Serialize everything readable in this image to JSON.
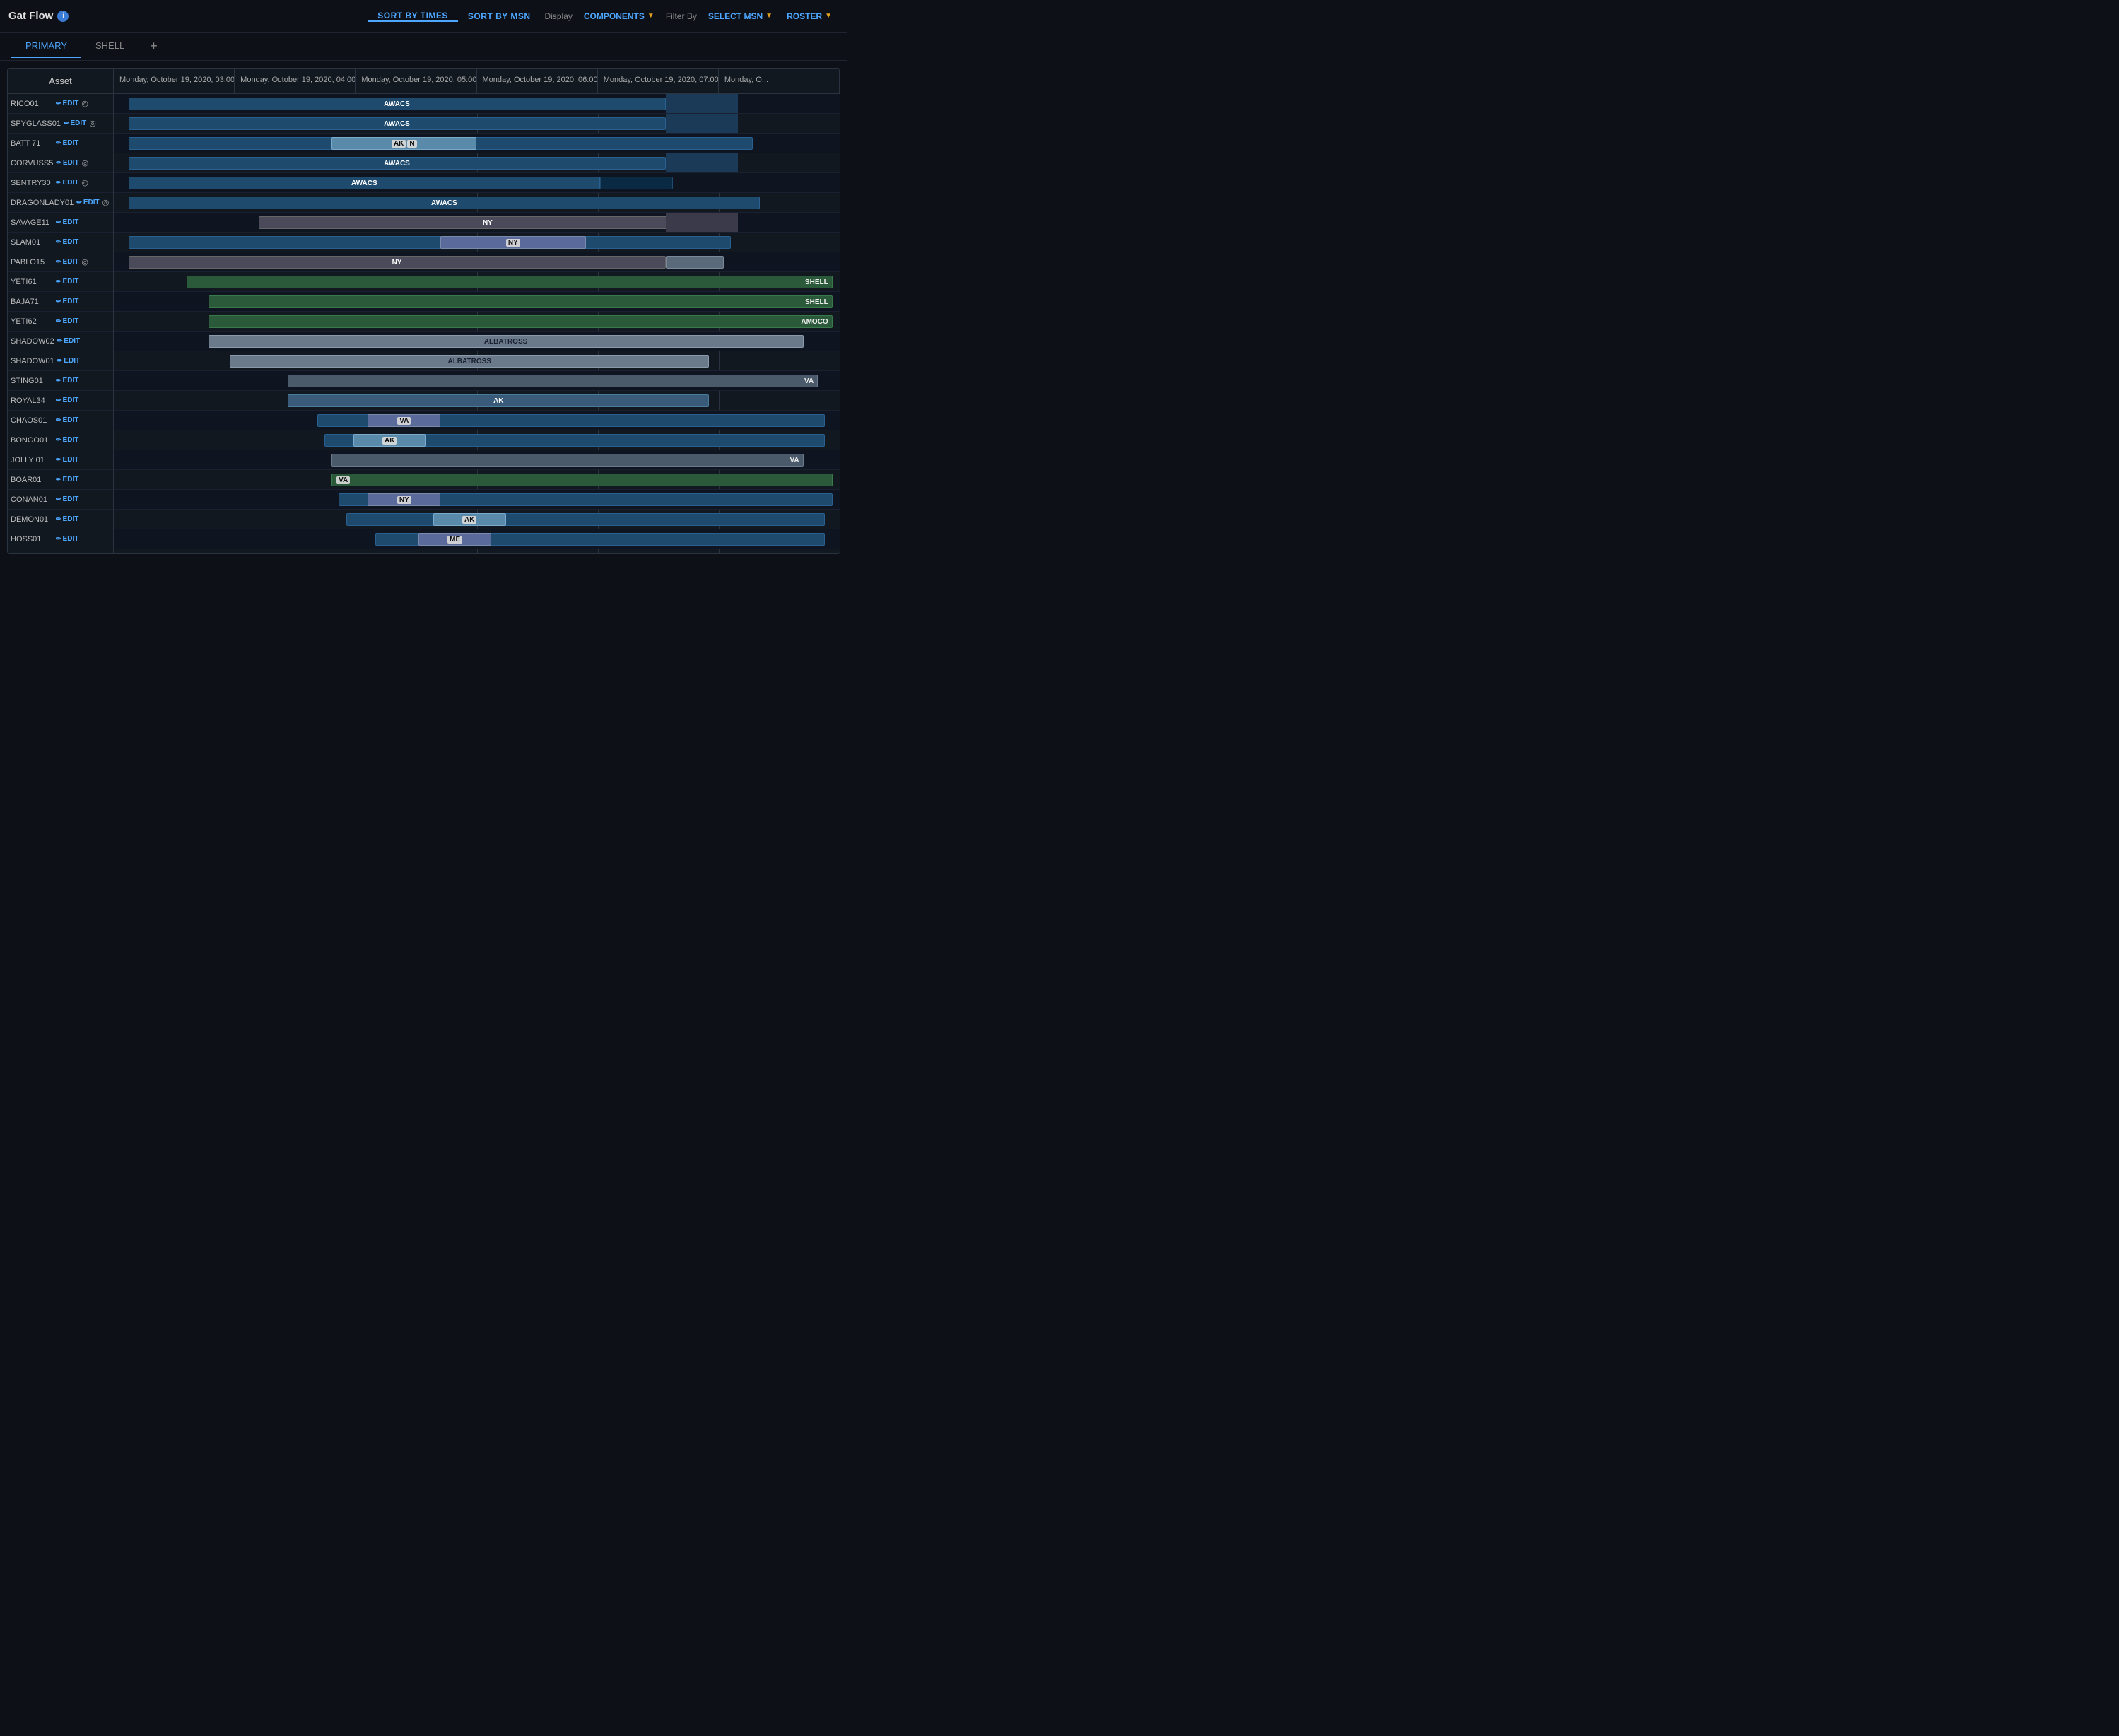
{
  "app": {
    "title": "Gat Flow",
    "info_icon": "i"
  },
  "nav": {
    "sort_times": "SORT BY TIMES",
    "sort_msn": "SORT BY MSN",
    "display_label": "Display",
    "components_label": "COMPONENTS",
    "filter_by_label": "Filter By",
    "select_msn_label": "SELECT MSN",
    "roster_label": "ROSTER"
  },
  "tabs": [
    {
      "label": "PRIMARY",
      "active": true
    },
    {
      "label": "SHELL",
      "active": false
    }
  ],
  "tab_add": "+",
  "gantt": {
    "asset_header": "Asset",
    "time_headers": [
      "Monday, October 19, 2020, 03:00",
      "Monday, October 19, 2020, 04:00",
      "Monday, October 19, 2020, 05:00",
      "Monday, October 19, 2020, 06:00",
      "Monday, October 19, 2020, 07:00",
      "Monday, O..."
    ],
    "rows": [
      {
        "id": "RICO01",
        "bar": "awacs",
        "label": "AWACS",
        "left_pct": 2,
        "width_pct": 74
      },
      {
        "id": "SPYGLASS01",
        "bar": "awacs",
        "label": "AWACS",
        "left_pct": 2,
        "width_pct": 74
      },
      {
        "id": "BATT 71",
        "bar": "ak",
        "label": "AK",
        "left_pct": 30,
        "width_pct": 55
      },
      {
        "id": "CORVUSS5",
        "bar": "awacs",
        "label": "AWACS",
        "left_pct": 2,
        "width_pct": 74
      },
      {
        "id": "SENTRY30",
        "bar": "awacs",
        "label": "AWACS",
        "left_pct": 2,
        "width_pct": 65
      },
      {
        "id": "DRAGONLADY01",
        "bar": "awacs",
        "label": "AWACS",
        "left_pct": 2,
        "width_pct": 85
      },
      {
        "id": "SAVAGE11",
        "bar": "ny",
        "label": "NY",
        "left_pct": 20,
        "width_pct": 63
      },
      {
        "id": "SLAM01",
        "bar": "ak",
        "label": "NY",
        "left_pct": 45,
        "width_pct": 40
      },
      {
        "id": "PABLO15",
        "bar": "ny",
        "label": "NY",
        "left_pct": 2,
        "width_pct": 74
      },
      {
        "id": "YETI61",
        "bar": "green",
        "label": "SHELL",
        "left_pct": 10,
        "width_pct": 87
      },
      {
        "id": "BAJA71",
        "bar": "green",
        "label": "SHELL",
        "left_pct": 13,
        "width_pct": 84
      },
      {
        "id": "YETI62",
        "bar": "green",
        "label": "AMOCO",
        "left_pct": 13,
        "width_pct": 84
      },
      {
        "id": "SHADOW02",
        "bar": "albatross",
        "label": "ALBATROSS",
        "left_pct": 13,
        "width_pct": 82
      },
      {
        "id": "SHADOW01",
        "bar": "albatross",
        "label": "ALBATROSS",
        "left_pct": 16,
        "width_pct": 66
      },
      {
        "id": "STING01",
        "bar": "va",
        "label": "VA",
        "left_pct": 24,
        "width_pct": 73
      },
      {
        "id": "ROYAL34",
        "bar": "ak",
        "label": "AK",
        "left_pct": 24,
        "width_pct": 58
      },
      {
        "id": "CHAOS01",
        "bar": "va",
        "label": "VA",
        "left_pct": 28,
        "width_pct": 69
      },
      {
        "id": "BONGO01",
        "bar": "ak",
        "label": "AK",
        "left_pct": 30,
        "width_pct": 67
      },
      {
        "id": "JOLLY 01",
        "bar": "va",
        "label": "VA",
        "left_pct": 30,
        "width_pct": 65
      },
      {
        "id": "BOAR01",
        "bar": "va",
        "label": "VA",
        "left_pct": 30,
        "width_pct": 67
      },
      {
        "id": "CONAN01",
        "bar": "ny",
        "label": "NY",
        "left_pct": 32,
        "width_pct": 65
      },
      {
        "id": "DEMON01",
        "bar": "ak",
        "label": "AK",
        "left_pct": 33,
        "width_pct": 64
      },
      {
        "id": "HOSS01",
        "bar": "me",
        "label": "ME",
        "left_pct": 38,
        "width_pct": 59
      }
    ]
  }
}
